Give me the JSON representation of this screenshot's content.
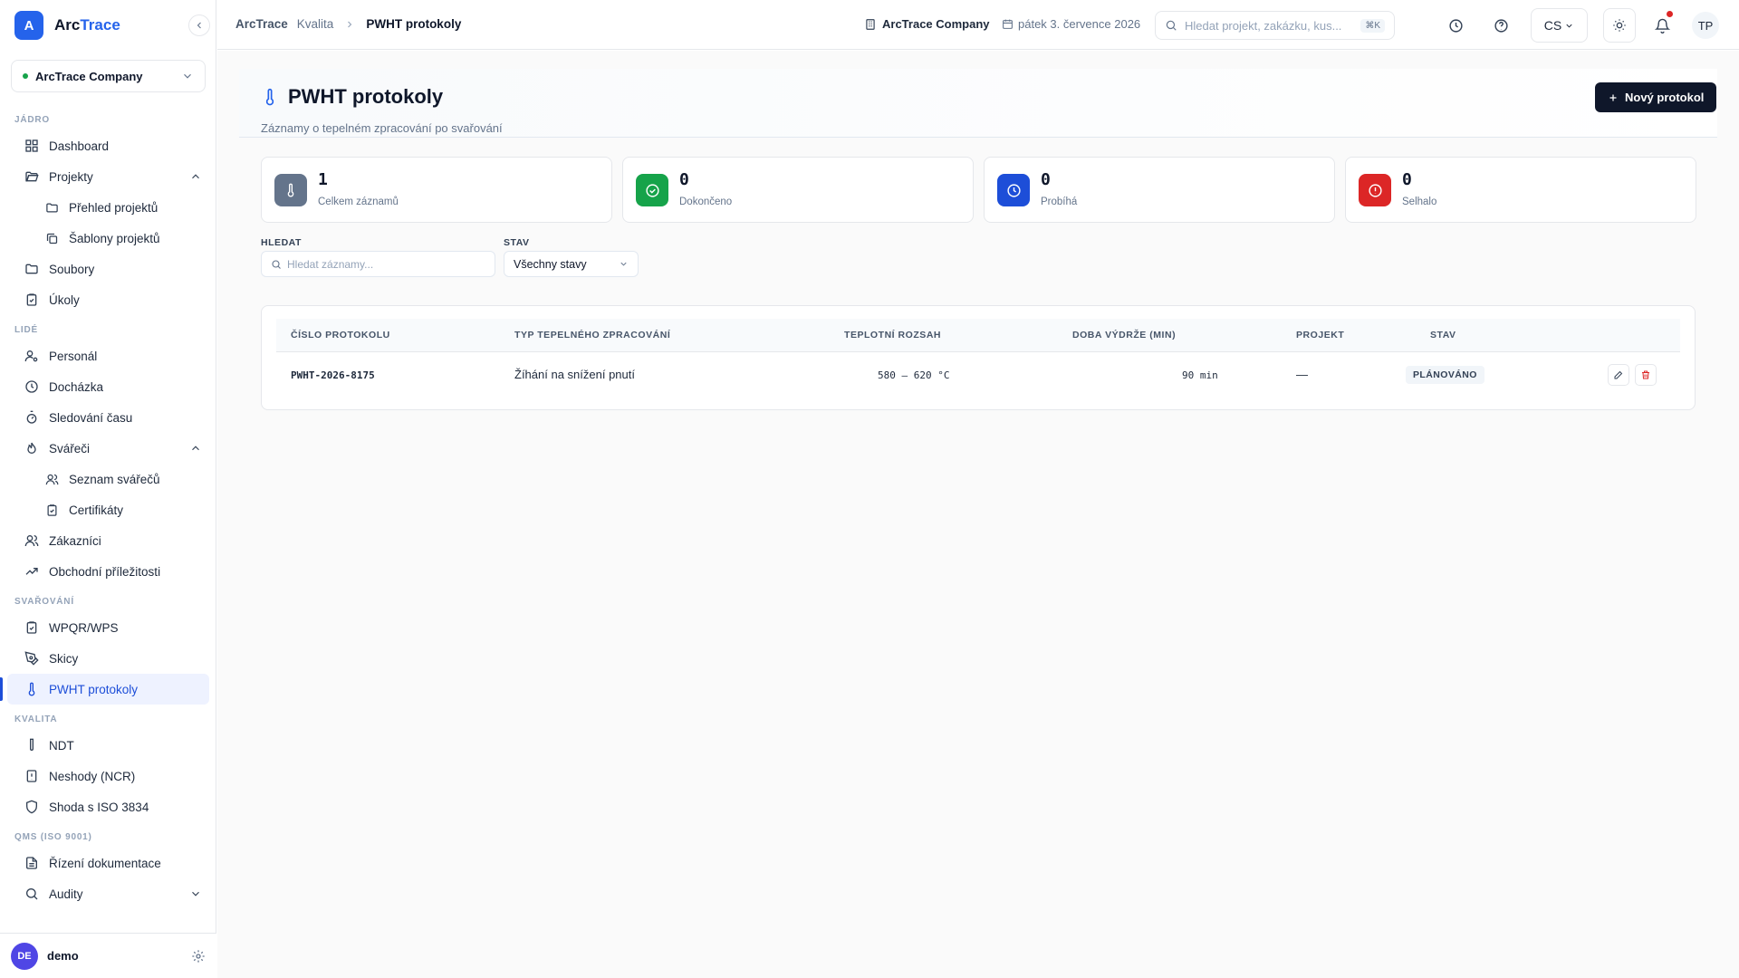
{
  "brand": {
    "logo_letter": "A",
    "name_part1": "Arc",
    "name_part2": "Trace"
  },
  "sidebar": {
    "company": "ArcTrace Company",
    "sections": {
      "core": "JÁDRO",
      "people": "LIDÉ",
      "welding": "SVAŘOVÁNÍ",
      "quality": "KVALITA",
      "qms": "QMS (ISO 9001)"
    },
    "items": {
      "dashboard": "Dashboard",
      "projects": "Projekty",
      "projects_overview": "Přehled projektů",
      "project_templates": "Šablony projektů",
      "files": "Soubory",
      "tasks": "Úkoly",
      "personnel": "Personál",
      "attendance": "Docházka",
      "time_tracking": "Sledování času",
      "welders": "Svářeči",
      "welders_list": "Seznam svářečů",
      "certificates": "Certifikáty",
      "customers": "Zákazníci",
      "opportunities": "Obchodní příležitosti",
      "wpqr": "WPQR/WPS",
      "sketches": "Skicy",
      "pwht": "PWHT protokoly",
      "ndt": "NDT",
      "ncr": "Neshody (NCR)",
      "iso3834": "Shoda s ISO 3834",
      "doc_control": "Řízení dokumentace",
      "audits": "Audity"
    },
    "user": {
      "initials": "DE",
      "name": "demo"
    }
  },
  "topbar": {
    "breadcrumb": {
      "root": "ArcTrace",
      "mid": "Kvalita",
      "current": "PWHT protokoly"
    },
    "company": "ArcTrace Company",
    "date": "pátek 3. července 2026",
    "search_placeholder": "Hledat projekt, zakázku, kus...",
    "search_shortcut": "⌘K",
    "language": "CS",
    "avatar_initials": "TP"
  },
  "page": {
    "title": "PWHT protokoly",
    "subtitle": "Záznamy o tepelném zpracování po svařování",
    "new_button": "Nový protokol"
  },
  "stats": [
    {
      "value": "1",
      "label": "Celkem záznamů",
      "color": "#64748b",
      "icon": "thermometer-icon"
    },
    {
      "value": "0",
      "label": "Dokončeno",
      "color": "#16a34a",
      "icon": "check-circle-icon"
    },
    {
      "value": "0",
      "label": "Probíhá",
      "color": "#1d4ed8",
      "icon": "clock-icon"
    },
    {
      "value": "0",
      "label": "Selhalo",
      "color": "#dc2626",
      "icon": "alert-circle-icon"
    }
  ],
  "filters": {
    "search_label": "HLEDAT",
    "search_placeholder": "Hledat záznamy...",
    "status_label": "STAV",
    "status_value": "Všechny stavy"
  },
  "table": {
    "columns": {
      "number": "ČÍSLO PROTOKOLU",
      "type": "TYP TEPELNÉHO ZPRACOVÁNÍ",
      "temp": "TEPLOTNÍ ROZSAH",
      "duration": "DOBA VÝDRŽE (MIN)",
      "project": "PROJEKT",
      "status": "STAV"
    },
    "rows": [
      {
        "number": "PWHT-2026-8175",
        "type": "Žíhání na snížení pnutí",
        "temp": "580 – 620 °C",
        "duration": "90 min",
        "project": "—",
        "status": "PLÁNOVÁNO"
      }
    ]
  }
}
